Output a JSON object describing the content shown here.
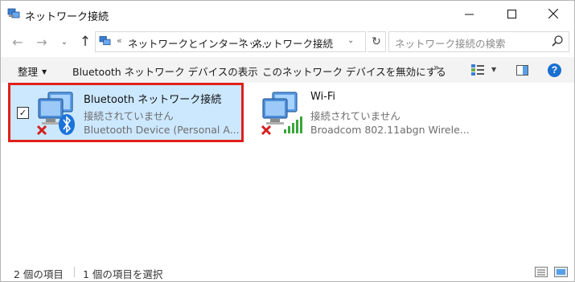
{
  "window": {
    "title": "ネットワーク接続"
  },
  "nav": {
    "back": "←",
    "forward": "→",
    "dropdown": "⌄",
    "up": "↑"
  },
  "address": {
    "chevrons": "«",
    "crumbs": [
      "ネットワークとインターネッ...",
      "ネットワーク接続"
    ],
    "separator": "›",
    "refresh": "↻"
  },
  "search": {
    "placeholder": "ネットワーク接続の検索"
  },
  "commands": {
    "organize": "整理",
    "bluetooth_devices": "Bluetooth ネットワーク デバイスの表示",
    "disable_device": "このネットワーク デバイスを無効にする",
    "more": "»",
    "help": "?"
  },
  "connections": [
    {
      "name": "Bluetooth ネットワーク接続",
      "status": "接続されていません",
      "device": "Bluetooth Device (Personal A...",
      "selected": true,
      "checked": true,
      "icon": "bluetooth-network-icon"
    },
    {
      "name": "Wi-Fi",
      "status": "接続されていません",
      "device": "Broadcom 802.11abgn Wirele...",
      "selected": false,
      "icon": "wifi-network-icon"
    }
  ],
  "status": {
    "item_count": "2 個の項目",
    "selected_count": "1 個の項目を選択"
  },
  "colors": {
    "selection": "#cce8ff",
    "highlight_border": "#e0201b",
    "help": "#1a6fd1",
    "bluetooth": "#1a73d9",
    "signal": "#3aa63a",
    "error_x": "#d42020"
  }
}
